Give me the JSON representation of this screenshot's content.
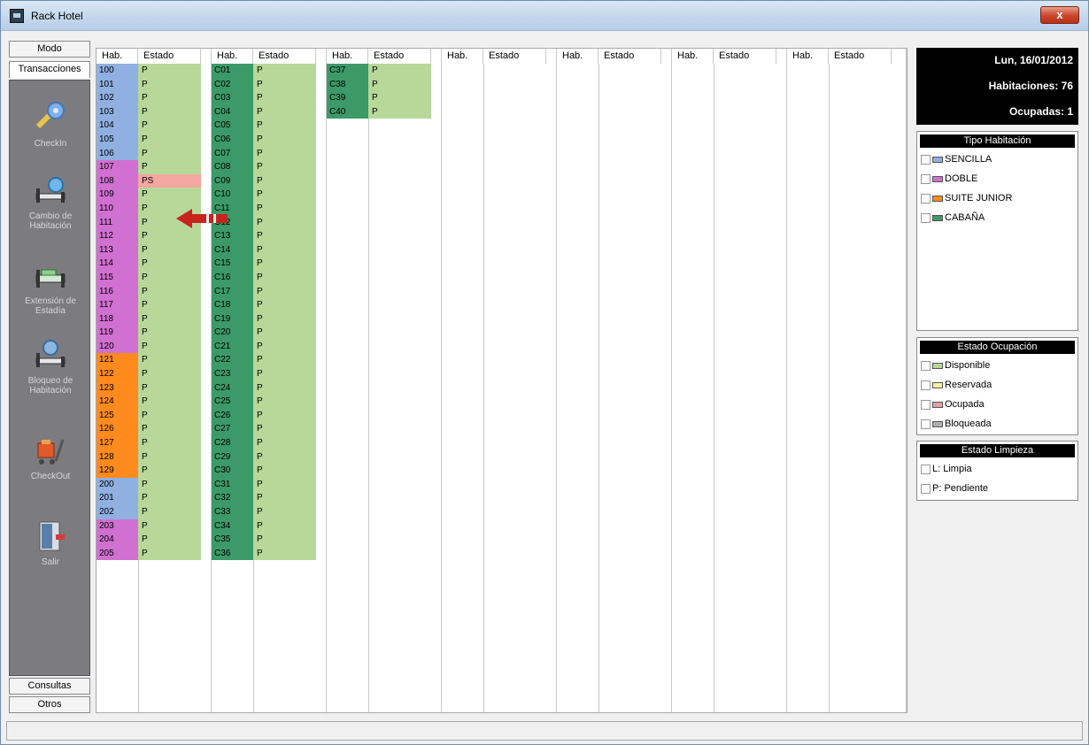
{
  "window": {
    "title": "Rack Hotel",
    "close_label": "x"
  },
  "nav": {
    "tabs_top": [
      "Modo",
      "Transacciones"
    ],
    "tabs_bottom": [
      "Consultas",
      "Otros"
    ],
    "items": [
      {
        "label": "CheckIn",
        "icon": "key-icon"
      },
      {
        "label": "Cambio de Habitación",
        "icon": "bed-swap-icon"
      },
      {
        "label": "Extensión de Estadía",
        "icon": "bed-extend-icon"
      },
      {
        "label": "Bloqueo de Habitación",
        "icon": "bed-lock-icon"
      },
      {
        "label": "CheckOut",
        "icon": "luggage-cart-icon"
      },
      {
        "label": "Salir",
        "icon": "exit-door-icon"
      }
    ]
  },
  "grid": {
    "header_hab": "Hab.",
    "header_estado": "Estado",
    "columns": [
      {
        "rooms": [
          "100",
          "101",
          "102",
          "103",
          "104",
          "105",
          "106",
          "107",
          "108",
          "109",
          "110",
          "111",
          "112",
          "113",
          "114",
          "115",
          "116",
          "117",
          "118",
          "119",
          "120",
          "121",
          "122",
          "123",
          "124",
          "125",
          "126",
          "127",
          "128",
          "129",
          "200",
          "201",
          "202",
          "203",
          "204",
          "205"
        ],
        "types": [
          "s",
          "s",
          "s",
          "s",
          "s",
          "s",
          "s",
          "d",
          "d",
          "d",
          "d",
          "d",
          "d",
          "d",
          "d",
          "d",
          "d",
          "d",
          "d",
          "d",
          "d",
          "j",
          "j",
          "j",
          "j",
          "j",
          "j",
          "j",
          "j",
          "j",
          "s",
          "s",
          "s",
          "d",
          "d",
          "d"
        ],
        "states": [
          "P",
          "P",
          "P",
          "P",
          "P",
          "P",
          "P",
          "P",
          "PS",
          "P",
          "P",
          "P",
          "P",
          "P",
          "P",
          "P",
          "P",
          "P",
          "P",
          "P",
          "P",
          "P",
          "P",
          "P",
          "P",
          "P",
          "P",
          "P",
          "P",
          "P",
          "P",
          "P",
          "P",
          "P",
          "P",
          "P"
        ]
      },
      {
        "rooms": [
          "C01",
          "C02",
          "C03",
          "C04",
          "C05",
          "C06",
          "C07",
          "C08",
          "C09",
          "C10",
          "C11",
          "C12",
          "C13",
          "C14",
          "C15",
          "C16",
          "C17",
          "C18",
          "C19",
          "C20",
          "C21",
          "C22",
          "C23",
          "C24",
          "C25",
          "C26",
          "C27",
          "C28",
          "C29",
          "C30",
          "C31",
          "C32",
          "C33",
          "C34",
          "C35",
          "C36"
        ],
        "types": [
          "c",
          "c",
          "c",
          "c",
          "c",
          "c",
          "c",
          "c",
          "c",
          "c",
          "c",
          "c",
          "c",
          "c",
          "c",
          "c",
          "c",
          "c",
          "c",
          "c",
          "c",
          "c",
          "c",
          "c",
          "c",
          "c",
          "c",
          "c",
          "c",
          "c",
          "c",
          "c",
          "c",
          "c",
          "c",
          "c"
        ],
        "states": [
          "P",
          "P",
          "P",
          "P",
          "P",
          "P",
          "P",
          "P",
          "P",
          "P",
          "P",
          "P",
          "P",
          "P",
          "P",
          "P",
          "P",
          "P",
          "P",
          "P",
          "P",
          "P",
          "P",
          "P",
          "P",
          "P",
          "P",
          "P",
          "P",
          "P",
          "P",
          "P",
          "P",
          "P",
          "P",
          "P"
        ]
      },
      {
        "rooms": [
          "C37",
          "C38",
          "C39",
          "C40"
        ],
        "types": [
          "c",
          "c",
          "c",
          "c"
        ],
        "states": [
          "P",
          "P",
          "P",
          "P"
        ]
      },
      {
        "rooms": [],
        "types": [],
        "states": []
      },
      {
        "rooms": [],
        "types": [],
        "states": []
      },
      {
        "rooms": [],
        "types": [],
        "states": []
      },
      {
        "rooms": [],
        "types": [],
        "states": []
      }
    ],
    "highlight": {
      "column": 0,
      "row": 8,
      "color": "#f4a6a0"
    }
  },
  "colors": {
    "s": "#8fb0e0",
    "d": "#d070d0",
    "j": "#ff8a1e",
    "c": "#3c9a68",
    "estado_disponible": "#b8d89a"
  },
  "info": {
    "date": "Lun, 16/01/2012",
    "habitaciones": "Habitaciones: 76",
    "ocupadas": "Ocupadas: 1"
  },
  "legend_tipo": {
    "title": "Tipo Habitación",
    "items": [
      {
        "label": "SENCILLA",
        "color": "#8fb0e0"
      },
      {
        "label": "DOBLE",
        "color": "#d070d0"
      },
      {
        "label": "SUITE JUNIOR",
        "color": "#ff8a1e"
      },
      {
        "label": "CABAÑA",
        "color": "#3c9a68"
      }
    ]
  },
  "legend_ocupacion": {
    "title": "Estado Ocupación",
    "items": [
      {
        "label": "Disponible",
        "color": "#b8d89a"
      },
      {
        "label": "Reservada",
        "color": "#f6f0a0"
      },
      {
        "label": "Ocupada",
        "color": "#e6a0a0"
      },
      {
        "label": "Bloqueada",
        "color": "#b0b0b0"
      }
    ]
  },
  "legend_limpieza": {
    "title": "Estado Limpieza",
    "items": [
      {
        "label": "L: Limpia"
      },
      {
        "label": "P: Pendiente"
      }
    ]
  }
}
